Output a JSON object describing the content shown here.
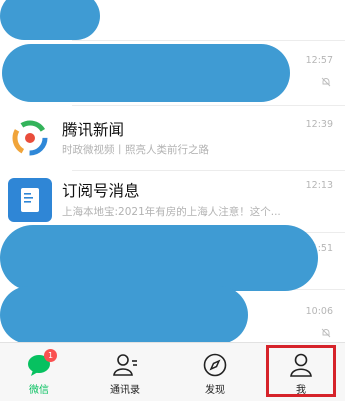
{
  "chat_list": {
    "rows": [
      {
        "time": "12:57"
      },
      {
        "title": "腾讯新闻",
        "preview": "时政微视频丨照亮人类前行之路",
        "time": "12:39"
      },
      {
        "title": "订阅号消息",
        "preview": "上海本地宝:2021年有房的上海人注意！这个...",
        "time": "12:13"
      },
      {
        "time": "11:51"
      },
      {
        "time": "10:06"
      }
    ]
  },
  "tabbar": {
    "tabs": [
      {
        "label": "微信",
        "badge": "1"
      },
      {
        "label": "通讯录"
      },
      {
        "label": "发现"
      },
      {
        "label": "我"
      }
    ]
  },
  "colors": {
    "accent": "#07c160",
    "badge": "#fa5151",
    "highlight": "#d6232a",
    "redaction": "#3f9bd3"
  }
}
